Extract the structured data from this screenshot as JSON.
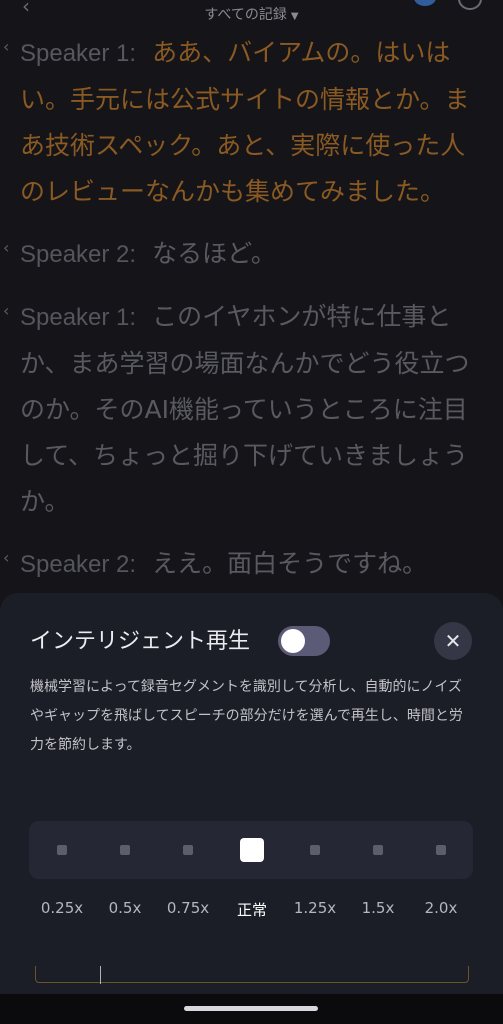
{
  "header": {
    "back_icon": "chevron-left-icon",
    "title": "すべての記録",
    "dropdown_caret": "▼"
  },
  "transcript": [
    {
      "speaker": "Speaker 1:",
      "text": "ああ、バイアムの。はいはい。手元には公式サイトの情報とか。まあ技術スペック。あと、実際に使った人のレビューなんかも集めてみました。",
      "active": true
    },
    {
      "speaker": "Speaker 2:",
      "text": "なるほど。",
      "active": false
    },
    {
      "speaker": "Speaker 1:",
      "text": "このイヤホンが特に仕事とか、まあ学習の場面なんかでどう役立つのか。そのAI機能っていうところに注目して、ちょっと掘り下げていきましょうか。",
      "active": false
    },
    {
      "speaker": "Speaker 2:",
      "text": "ええ。面白そうですね。",
      "active": false
    }
  ],
  "sheet": {
    "title": "インテリジェント再生",
    "toggle_on": false,
    "close_label": "✕",
    "description": "機械学習によって録音セグメントを識別して分析し、自動的にノイズやギャップを飛ばしてスピーチの部分だけを選んで再生し、時間と労力を節約します。",
    "speeds": [
      "0.25x",
      "0.5x",
      "0.75x",
      "正常",
      "1.25x",
      "1.5x",
      "2.0x"
    ],
    "selected_speed": "正常"
  },
  "colors": {
    "background": "#141419",
    "active_text": "#8a5a22",
    "inactive_text": "#595960",
    "sheet_bg": "#1c1e27"
  }
}
